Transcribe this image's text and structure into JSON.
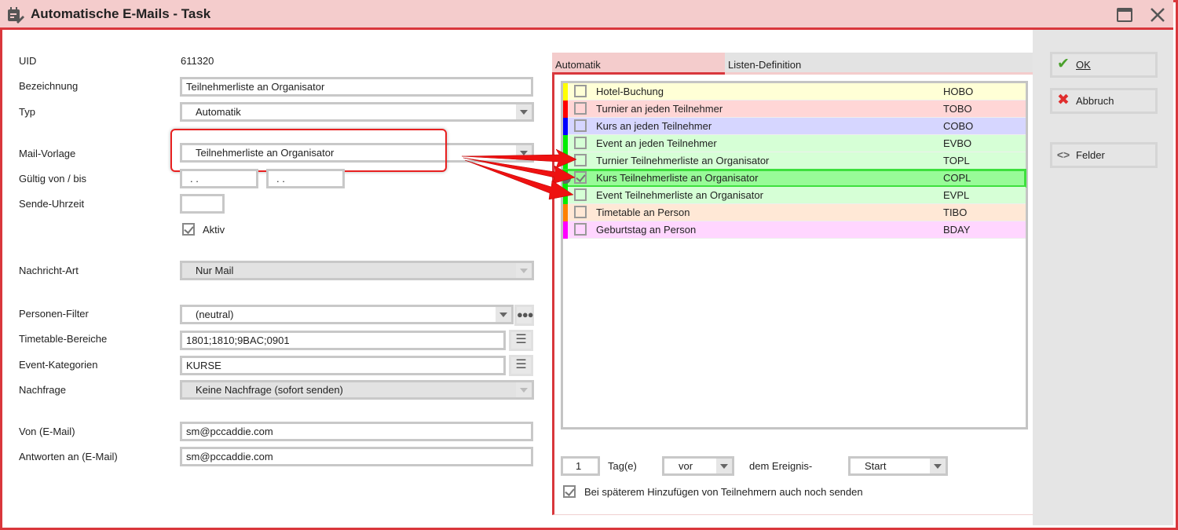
{
  "window": {
    "title": "Automatische E-Mails - Task",
    "icon": "calendar-edit-icon"
  },
  "form": {
    "uid_label": "UID",
    "uid_value": "611320",
    "bezeichnung_label": "Bezeichnung",
    "bezeichnung_value": "Teilnehmerliste an Organisator",
    "typ_label": "Typ",
    "typ_value": "Automatik",
    "mailvorlage_label": "Mail-Vorlage",
    "mailvorlage_value": "Teilnehmerliste an Organisator",
    "gueltig_label": "Gültig von / bis",
    "gueltig_von": ". .",
    "gueltig_bis": ". .",
    "sendezeit_label": "Sende-Uhrzeit",
    "sendezeit_value": "",
    "aktiv_label": "Aktiv",
    "aktiv_checked": true,
    "nachrichtart_label": "Nachricht-Art",
    "nachrichtart_value": "Nur Mail",
    "personenfilter_label": "Personen-Filter",
    "personenfilter_value": "(neutral)",
    "timetable_label": "Timetable-Bereiche",
    "timetable_value": "1801;1810;9BAC;0901",
    "eventkat_label": "Event-Kategorien",
    "eventkat_value": "KURSE",
    "nachfrage_label": "Nachfrage",
    "nachfrage_value": "Keine Nachfrage (sofort senden)",
    "von_label": "Von (E-Mail)",
    "von_value": "sm@pccaddie.com",
    "antworten_label": "Antworten an (E-Mail)",
    "antworten_value": "sm@pccaddie.com"
  },
  "tabs": [
    {
      "label": "Automatik",
      "active": true
    },
    {
      "label": "Listen-Definition",
      "active": false
    }
  ],
  "list": [
    {
      "name": "Hotel-Buchung",
      "code": "HOBO",
      "color": "#ffff00",
      "bg": "#ffffd6",
      "checked": false
    },
    {
      "name": "Turnier an jeden Teilnehmer",
      "code": "TOBO",
      "color": "#ff0000",
      "bg": "#ffd6d6",
      "checked": false
    },
    {
      "name": "Kurs an jeden Teilnehmer",
      "code": "COBO",
      "color": "#0000ff",
      "bg": "#d6d6ff",
      "checked": false
    },
    {
      "name": "Event an jeden Teilnehmer",
      "code": "EVBO",
      "color": "#00ee00",
      "bg": "#d6ffd6",
      "checked": false
    },
    {
      "name": "Turnier Teilnehmerliste an Organisator",
      "code": "TOPL",
      "color": "#00ee00",
      "bg": "#d6ffd6",
      "checked": false
    },
    {
      "name": "Kurs Teilnehmerliste an Organisator",
      "code": "COPL",
      "color": "#00ee00",
      "bg": "#98fb98",
      "checked": true,
      "selected": true
    },
    {
      "name": "Event Teilnehmerliste an Organisator",
      "code": "EVPL",
      "color": "#00ee00",
      "bg": "#d6ffd6",
      "checked": false
    },
    {
      "name": "Timetable an Person",
      "code": "TIBO",
      "color": "#ff8000",
      "bg": "#ffe8d6",
      "checked": false
    },
    {
      "name": "Geburtstag an Person",
      "code": "BDAY",
      "color": "#ff00ff",
      "bg": "#ffd6ff",
      "checked": false
    }
  ],
  "timing": {
    "days": "1",
    "days_label": "Tag(e)",
    "direction": "vor",
    "event_label": "dem Ereignis-",
    "event_point": "Start",
    "late_add_label": "Bei späterem Hinzufügen von Teilnehmern auch noch senden",
    "late_add_checked": true
  },
  "buttons": {
    "ok": "OK",
    "cancel": "Abbruch",
    "fields": "Felder"
  }
}
